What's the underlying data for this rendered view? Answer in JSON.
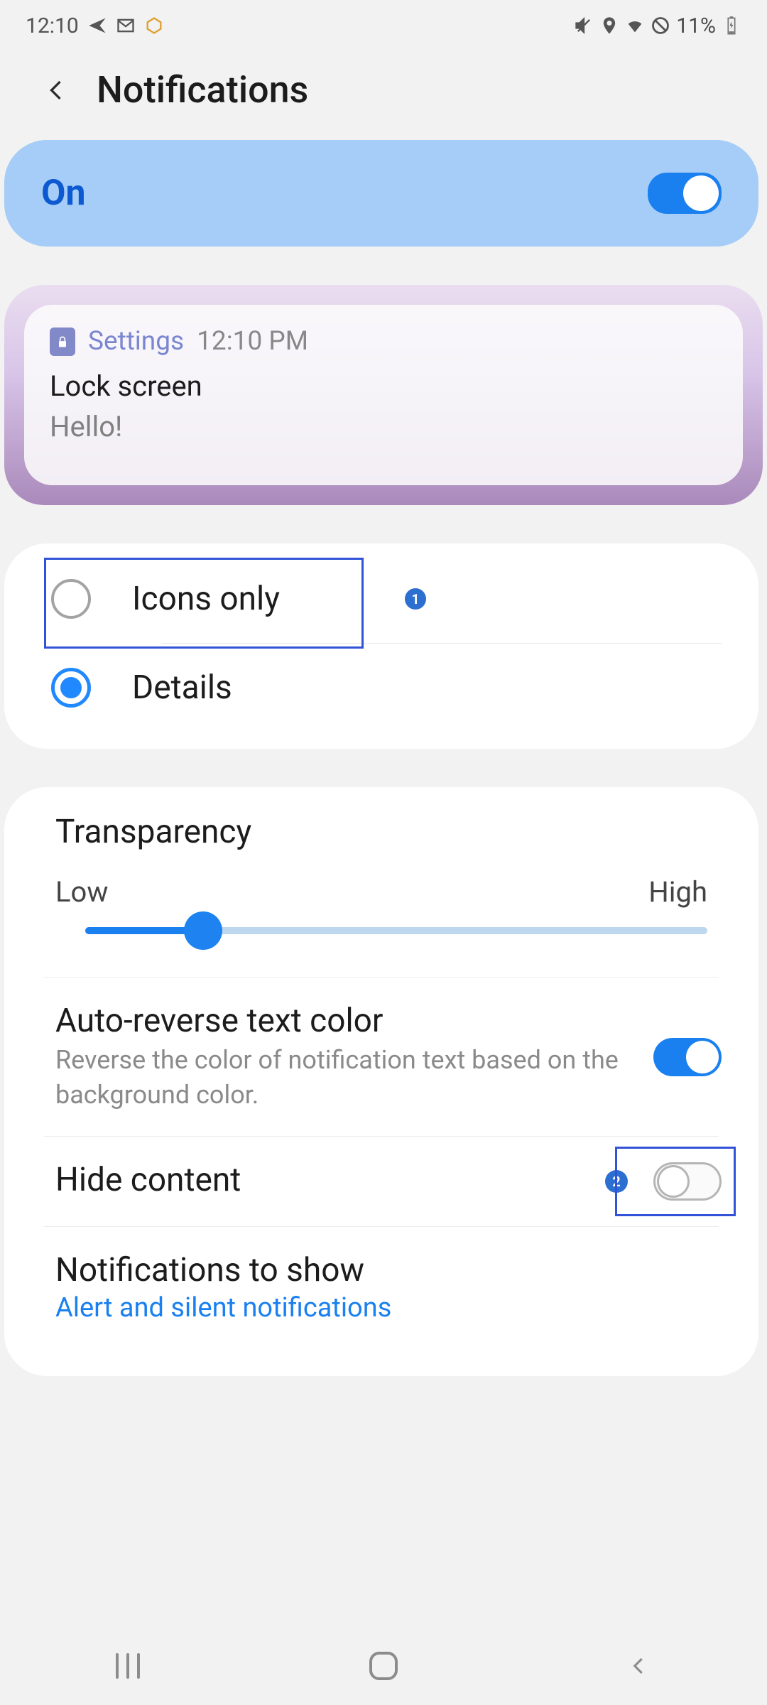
{
  "statusBar": {
    "time": "12:10",
    "battery": "11%"
  },
  "header": {
    "title": "Notifications"
  },
  "masterToggle": {
    "label": "On",
    "on": true
  },
  "preview": {
    "app": "Settings",
    "time": "12:10 PM",
    "title": "Lock screen",
    "body": "Hello!"
  },
  "styles": {
    "option1": "Icons only",
    "option2": "Details",
    "badge1": "1"
  },
  "transparency": {
    "title": "Transparency",
    "low": "Low",
    "high": "High"
  },
  "autoReverse": {
    "title": "Auto-reverse text color",
    "sub": "Reverse the color of notification text based on the background color."
  },
  "hideContent": {
    "title": "Hide content",
    "badge": "2"
  },
  "notifsToShow": {
    "title": "Notifications to show",
    "value": "Alert and silent notifications"
  }
}
